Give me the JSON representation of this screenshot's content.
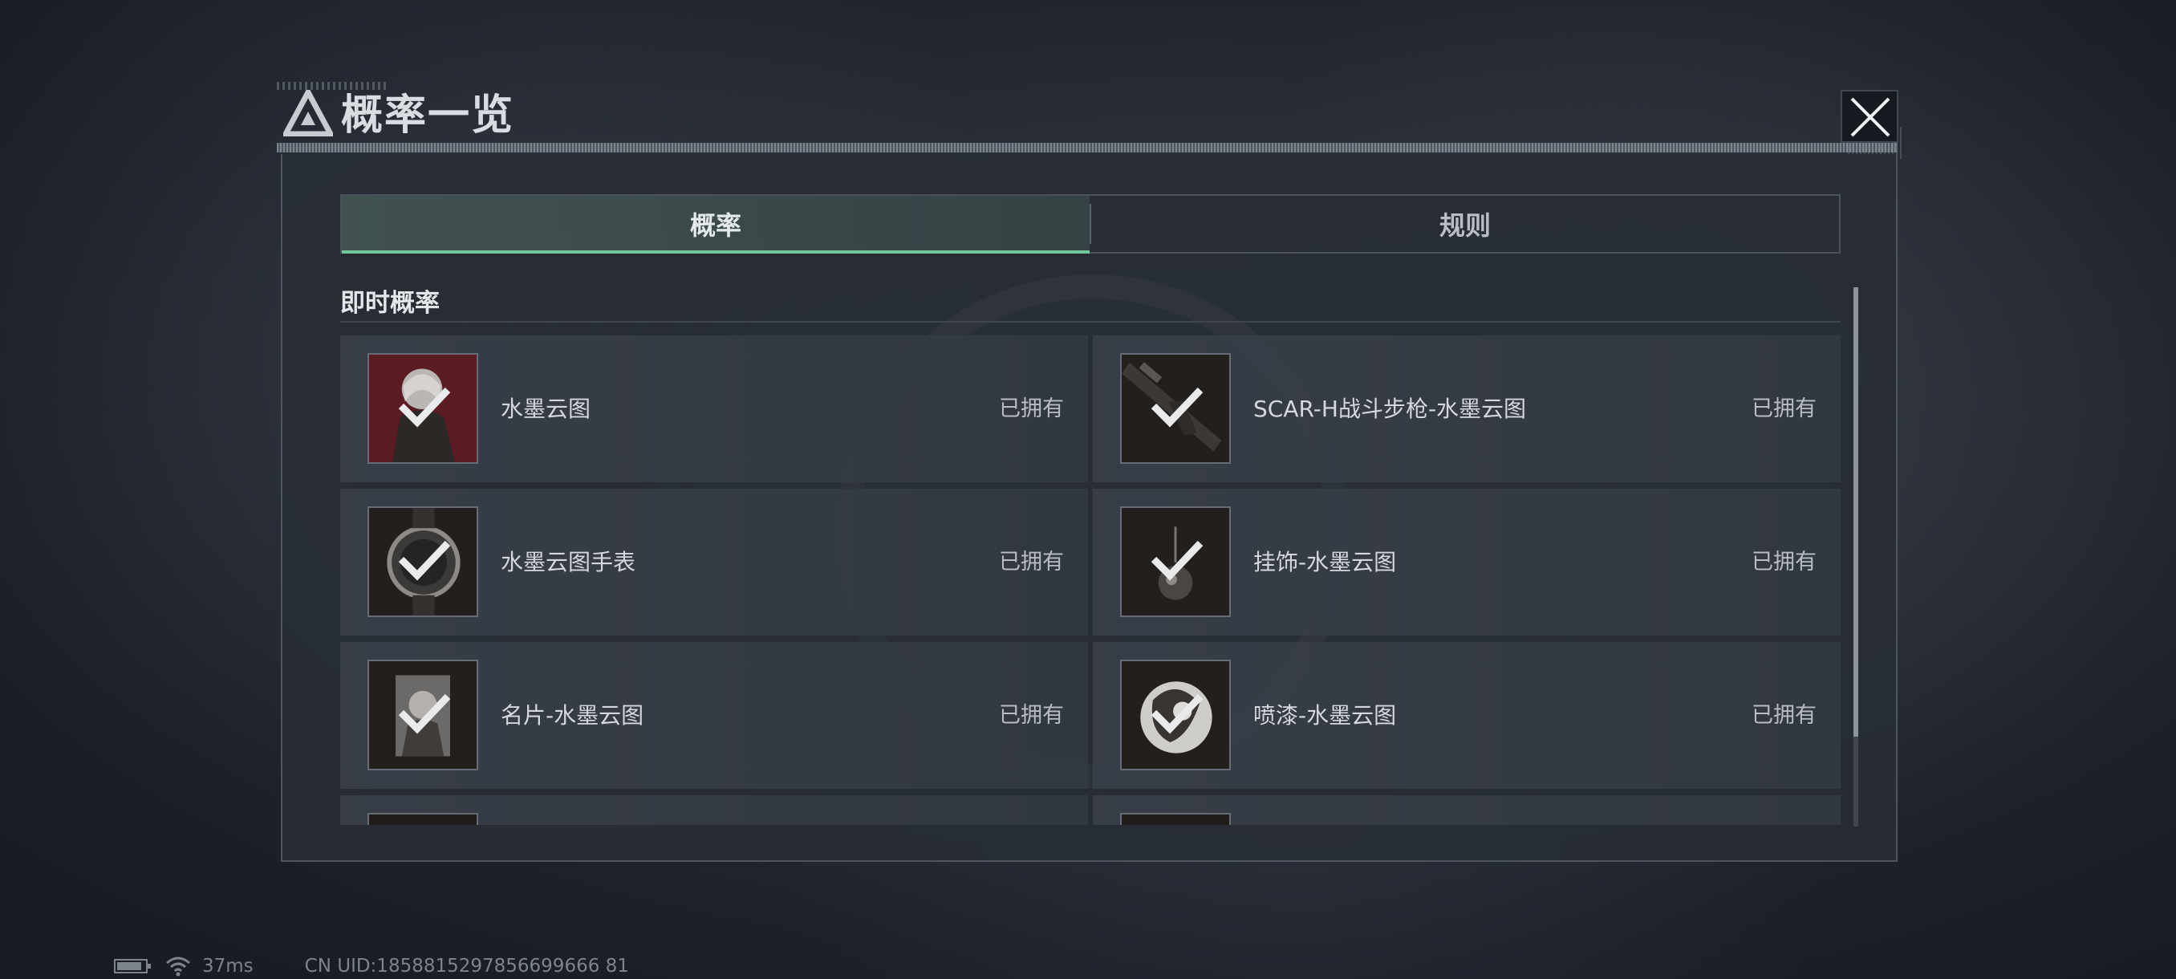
{
  "window": {
    "title": "概率一览"
  },
  "tabs": [
    {
      "label": "概率",
      "active": true
    },
    {
      "label": "规则",
      "active": false
    }
  ],
  "section": {
    "title": "即时概率"
  },
  "items": [
    {
      "name": "水墨云图",
      "status": "已拥有",
      "icon": "character-portrait-icon"
    },
    {
      "name": "SCAR-H战斗步枪-水墨云图",
      "status": "已拥有",
      "icon": "rifle-icon"
    },
    {
      "name": "水墨云图手表",
      "status": "已拥有",
      "icon": "watch-icon"
    },
    {
      "name": "挂饰-水墨云图",
      "status": "已拥有",
      "icon": "charm-icon"
    },
    {
      "name": "名片-水墨云图",
      "status": "已拥有",
      "icon": "name-card-icon"
    },
    {
      "name": "喷漆-水墨云图",
      "status": "已拥有",
      "icon": "spray-icon"
    }
  ],
  "footer": {
    "ping": "37ms",
    "uid": "CN UID:1858815297856699666 81"
  },
  "colors": {
    "accent": "#6fc79a",
    "panel": "#282d35",
    "text": "#d4d8dc"
  }
}
